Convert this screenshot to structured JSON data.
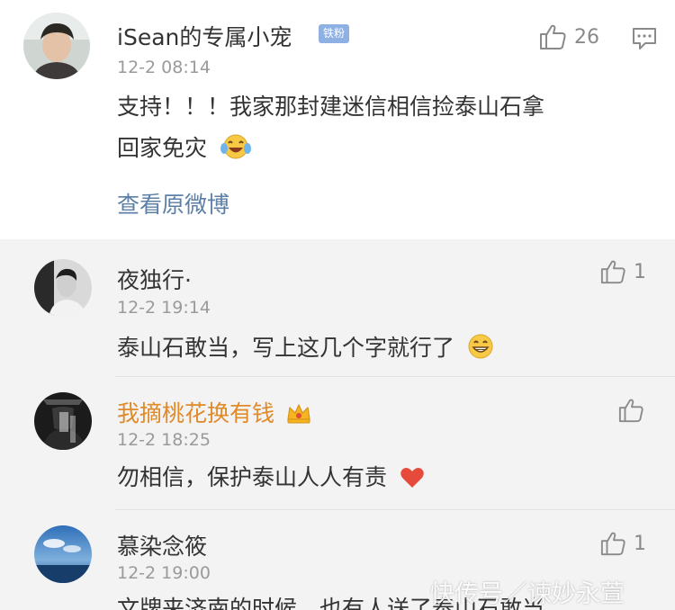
{
  "main_comment": {
    "username": "iSean的专属小宠",
    "badge": "铁粉",
    "time": "12-2 08:14",
    "like_count": "26",
    "text_line1": "支持！！！我家那封建迷信相信捡泰山石拿",
    "text_line2": "回家免灾",
    "view_original": "查看原微博"
  },
  "replies": [
    {
      "username": "夜独行·",
      "time": "12-2 19:14",
      "like_count": "1",
      "text": "泰山石敢当，写上这几个字就行了"
    },
    {
      "username": "我摘桃花换有钱",
      "time": "12-2 18:25",
      "like_count": "",
      "text": "勿相信，保护泰山人人有责"
    },
    {
      "username": "慕染念筱",
      "time": "12-2 19:00",
      "like_count": "1",
      "text": "文牌来济南的时候，也有人送了泰山石敢当"
    }
  ],
  "watermark": "快传号／谏妙永萱",
  "colors": {
    "link": "#5c7fa8",
    "vip_name": "#e08a2a",
    "badge": "#8fb0e3",
    "reply_bg": "#f3f3f3"
  }
}
